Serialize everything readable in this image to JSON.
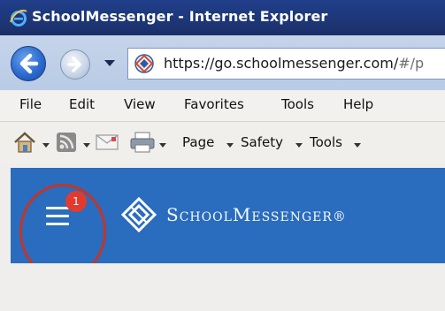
{
  "window": {
    "title": "SchoolMessenger - Internet Explorer"
  },
  "address_bar": {
    "url_main": "https://go.schoolmessenger.com/",
    "url_rest": "#/p"
  },
  "menu_bar": {
    "items": [
      "File",
      "Edit",
      "View",
      "Favorites",
      "Tools",
      "Help"
    ]
  },
  "command_bar": {
    "items": [
      "Page",
      "Safety",
      "Tools"
    ]
  },
  "app_header": {
    "brand": "SchoolMessenger",
    "brand_mark": "®",
    "notification_count": "1",
    "colors": {
      "header": "#2a6cbe",
      "badge": "#e23b2e",
      "highlight_ring": "#c0362a"
    }
  },
  "icons": [
    "ie-logo-icon",
    "back-arrow-icon",
    "forward-arrow-icon",
    "site-favicon-icon",
    "home-icon",
    "rss-feed-icon",
    "mail-icon",
    "print-icon",
    "hamburger-menu-icon",
    "schoolmessenger-logo-icon"
  ]
}
